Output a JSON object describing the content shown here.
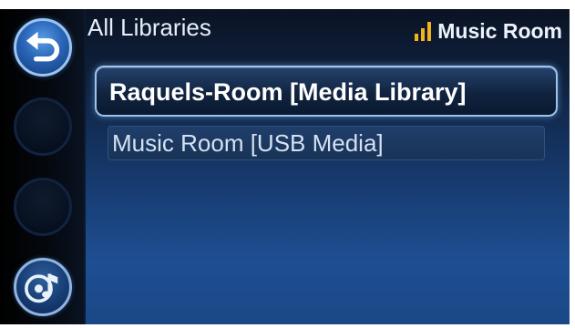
{
  "header": {
    "title": "All Libraries"
  },
  "zone": {
    "name": "Music Room",
    "signal_icon": "signal-bars-icon",
    "signal_color": "#f2b21c"
  },
  "sidebar": {
    "buttons": [
      {
        "name": "back",
        "icon": "back-arrow-icon"
      },
      {
        "name": "empty"
      },
      {
        "name": "empty"
      },
      {
        "name": "music-source",
        "icon": "music-disc-icon"
      }
    ]
  },
  "libraries": [
    {
      "label": "Raquels-Room [Media Library]",
      "selected": true
    },
    {
      "label": "Music Room [USB Media]",
      "selected": false
    }
  ]
}
